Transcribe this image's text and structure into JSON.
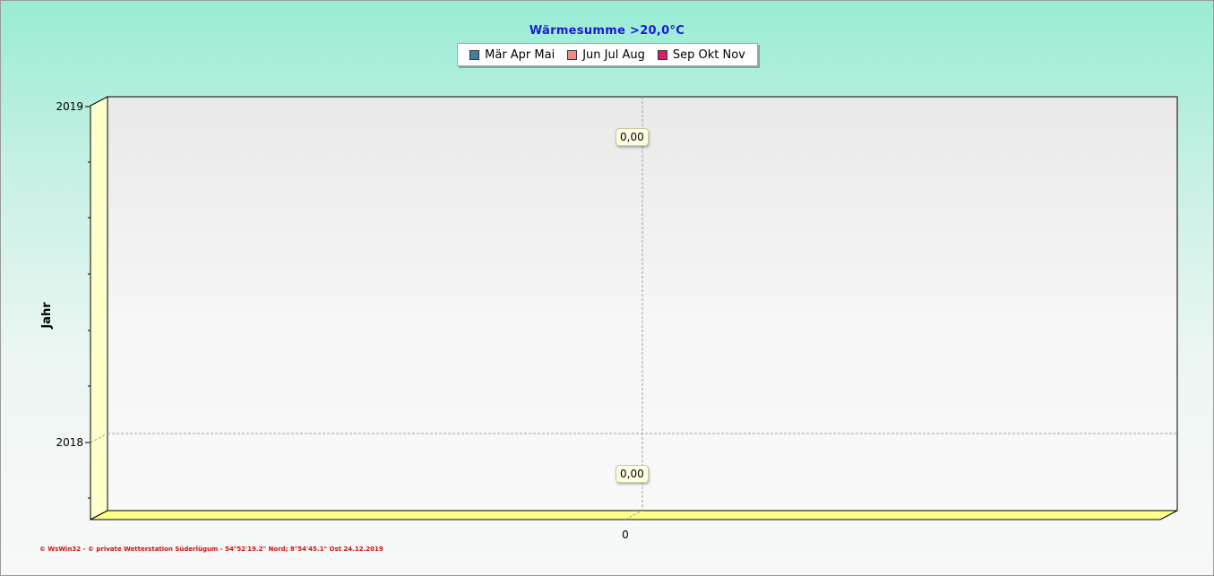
{
  "chart_data": {
    "type": "bar",
    "orientation": "horizontal",
    "title": "Wärmesumme  >20,0°C",
    "ylabel": "Jahr",
    "xlabel": "",
    "categories": [
      "2018",
      "2019"
    ],
    "series": [
      {
        "name": "Mär Apr Mai",
        "color": "#3f7f9f",
        "values": [
          0,
          0
        ]
      },
      {
        "name": "Jun Jul Aug",
        "color": "#f08a80",
        "values": [
          0,
          0
        ]
      },
      {
        "name": "Sep Okt Nov",
        "color": "#d81f6a",
        "values": [
          0,
          0
        ]
      }
    ],
    "x_ticks": [
      "0"
    ],
    "data_labels": [
      "0,00",
      "0,00"
    ],
    "grid": true,
    "legend_position": "top-center",
    "floor_color": "#ffff88",
    "side_wall_color": "#ffffcc"
  },
  "footer": {
    "text": "© WsWin32 - © private Wetterstation Süderlügum - 54°52'19.2\" Nord; 8°54'45.1\" Ost 24.12.2019"
  }
}
